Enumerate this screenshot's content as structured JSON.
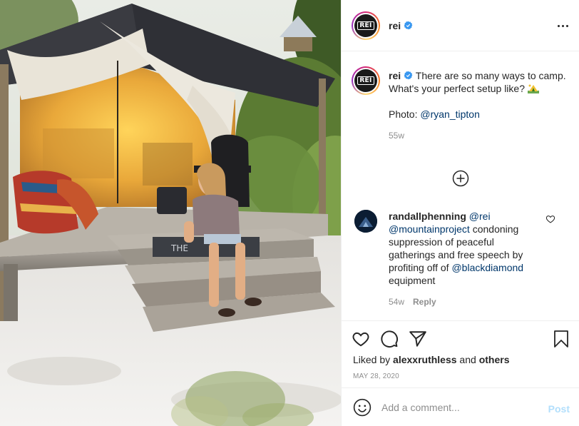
{
  "post": {
    "username": "rei",
    "verified": true,
    "avatar_text": "REI"
  },
  "caption": {
    "username": "rei",
    "text_part1": "There are so many ways to camp. What's your perfect setup like?",
    "emoji": "camping-tent-emoji",
    "photo_label": "Photo: ",
    "photo_mention": "@ryan_tipton",
    "age": "55w"
  },
  "comment": {
    "username": "randallphenning",
    "mention1": "@rei",
    "mention2": "@mountainproject",
    "text_mid": " condoning suppression of peaceful gatherings and free speech by profiting off of ",
    "mention3": "@blackdiamond",
    "text_end": " equipment",
    "age": "54w",
    "reply_label": "Reply"
  },
  "engagement": {
    "liked_by_prefix": "Liked by ",
    "liked_by_user": "alexxruthless",
    "liked_by_and": " and ",
    "liked_by_others": "others",
    "date": "MAY 28, 2020"
  },
  "add_comment": {
    "placeholder": "Add a comment...",
    "post_label": "Post"
  },
  "icons": {
    "more": "more-dots-icon",
    "verified": "verified-badge-icon",
    "load_more": "plus-circle-icon",
    "like": "heart-icon",
    "comment": "comment-bubble-icon",
    "share": "paper-plane-icon",
    "save": "bookmark-icon",
    "emoji": "smiley-icon"
  },
  "colors": {
    "link": "#00376b",
    "verified": "#3897f0",
    "muted": "#8e8e8e",
    "post_disabled": "#b2dffc"
  }
}
